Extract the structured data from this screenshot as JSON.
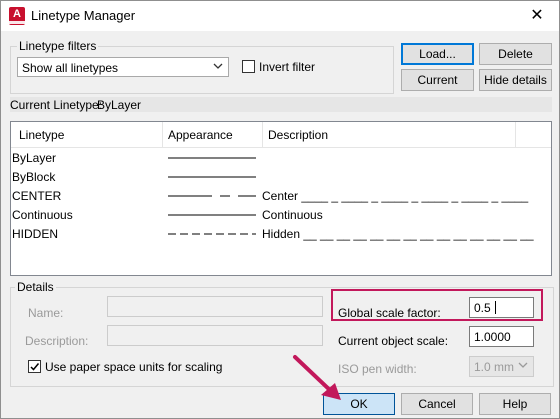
{
  "window": {
    "title": "Linetype Manager",
    "close_glyph": "✕",
    "app_icon": "autocad-app-icon",
    "app_icon_letter": "A"
  },
  "filters": {
    "group_label": "Linetype filters",
    "selected": "Show all linetypes",
    "invert_label": "Invert filter",
    "invert_checked": false
  },
  "buttons": {
    "load": "Load...",
    "delete": "Delete",
    "current": "Current",
    "hide_details": "Hide details",
    "ok": "OK",
    "cancel": "Cancel",
    "help": "Help"
  },
  "current_linetype": {
    "label": "Current Linetype:",
    "value": "ByLayer"
  },
  "table": {
    "headers": [
      "Linetype",
      "Appearance",
      "Description"
    ],
    "rows": [
      {
        "name": "ByLayer",
        "description": "",
        "pattern": "solid"
      },
      {
        "name": "ByBlock",
        "description": "",
        "pattern": "solid"
      },
      {
        "name": "CENTER",
        "description": "Center ____ _ ____ _ ____ _ ____ _ ____ _ ____",
        "pattern": "center"
      },
      {
        "name": "Continuous",
        "description": "Continuous",
        "pattern": "solid"
      },
      {
        "name": "HIDDEN",
        "description": "Hidden __ __ __ __ __ __ __ __ __ __ __ __ __ __",
        "pattern": "hidden"
      }
    ]
  },
  "details": {
    "group_label": "Details",
    "name_label": "Name:",
    "description_label": "Description:",
    "paper_space_label": "Use paper space units for scaling",
    "paper_space_checked": true,
    "global_scale_label": "Global scale factor:",
    "global_scale_value": "0.5",
    "current_object_scale_label": "Current object scale:",
    "current_object_scale_value": "1.0000",
    "iso_pen_label": "ISO pen width:",
    "iso_pen_value": "1.0 mm"
  },
  "colors": {
    "highlight": "#c2185b",
    "accent": "#0078d7",
    "app_red": "#c8102e"
  }
}
